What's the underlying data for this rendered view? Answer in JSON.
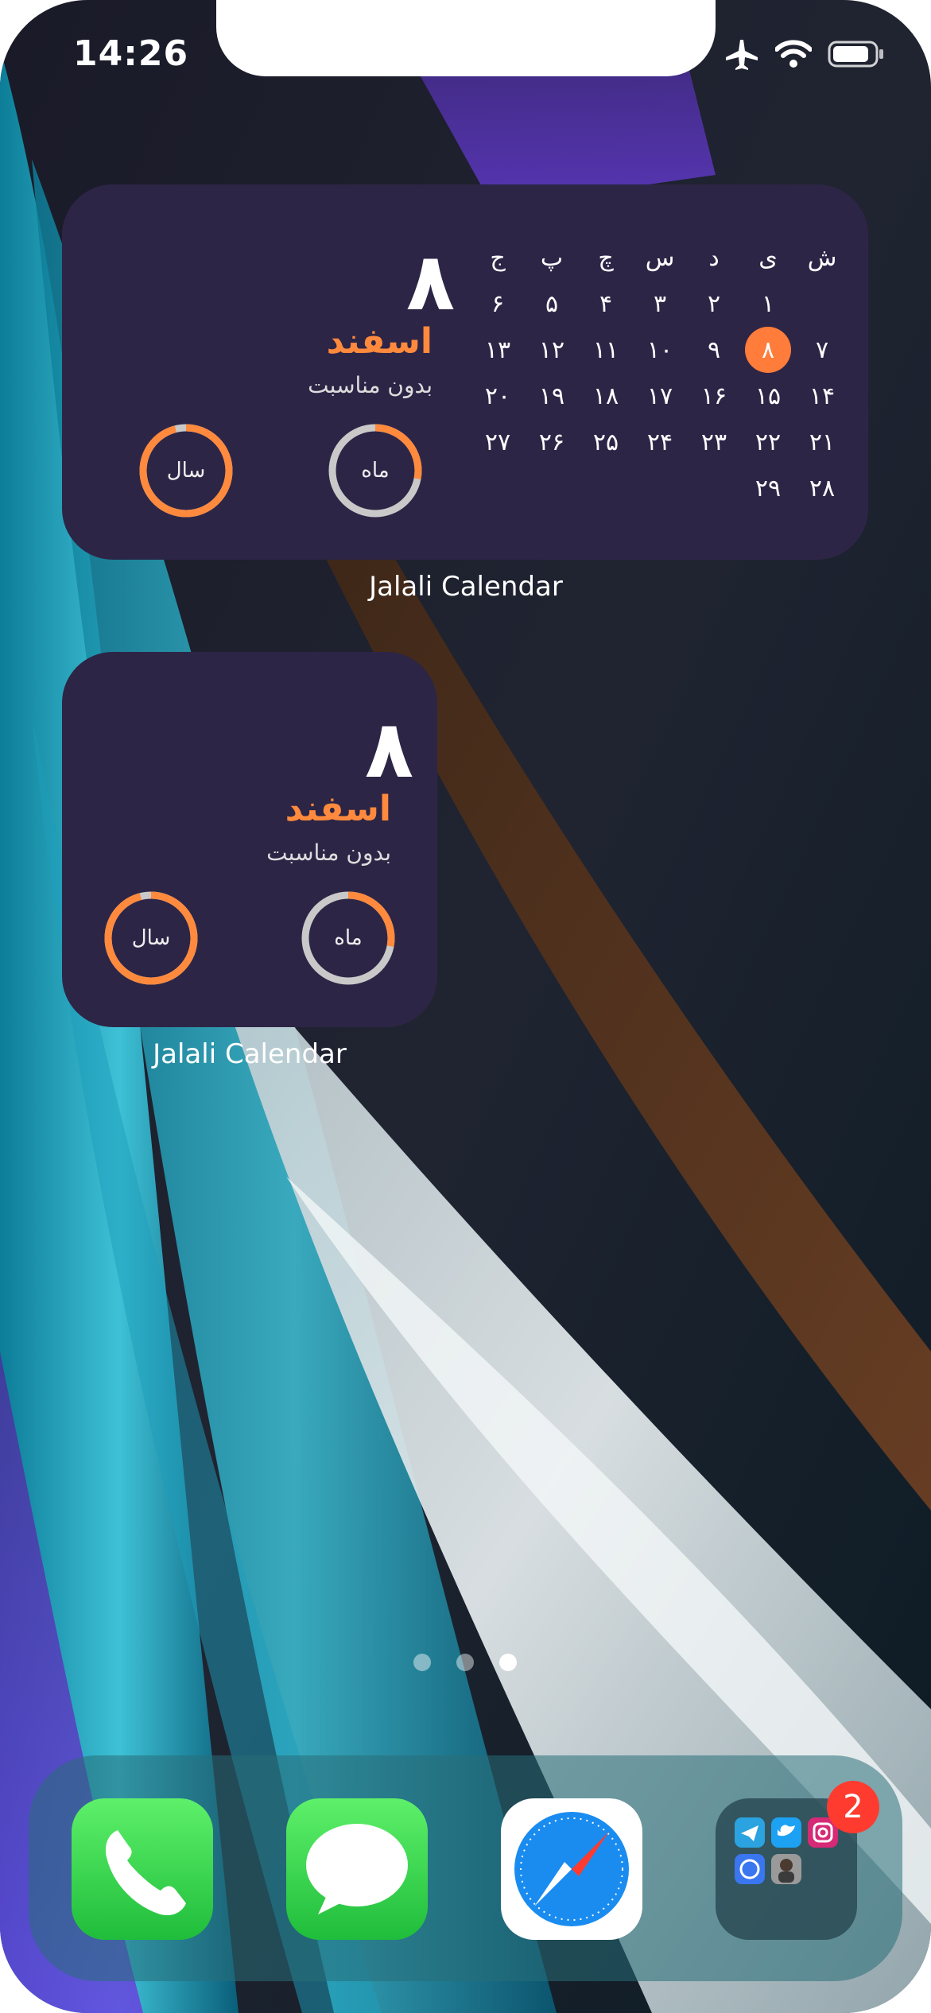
{
  "status_bar": {
    "time": "14:26"
  },
  "widget_large": {
    "day": "۸",
    "month": "اسفند",
    "occasion": "بدون مناسبت",
    "ring_month_label": "ماه",
    "ring_year_label": "سال",
    "ring_month_progress": 0.28,
    "ring_year_progress": 0.96,
    "weekday_headers": [
      "ش",
      "ی",
      "د",
      "س",
      "چ",
      "پ",
      "ج"
    ],
    "weeks": [
      [
        "",
        "۱",
        "۲",
        "۳",
        "۴",
        "۵",
        "۶"
      ],
      [
        "۷",
        "۸",
        "۹",
        "۱۰",
        "۱۱",
        "۱۲",
        "۱۳"
      ],
      [
        "۱۴",
        "۱۵",
        "۱۶",
        "۱۷",
        "۱۸",
        "۱۹",
        "۲۰"
      ],
      [
        "۲۱",
        "۲۲",
        "۲۳",
        "۲۴",
        "۲۵",
        "۲۶",
        "۲۷"
      ],
      [
        "۲۸",
        "۲۹",
        "",
        "",
        "",
        "",
        ""
      ]
    ],
    "today": "۸",
    "caption": "Jalali Calendar"
  },
  "widget_small": {
    "day": "۸",
    "month": "اسفند",
    "occasion": "بدون مناسبت",
    "ring_month_label": "ماه",
    "ring_year_label": "سال",
    "ring_month_progress": 0.28,
    "ring_year_progress": 0.96,
    "caption": "Jalali Calendar"
  },
  "page_dots": {
    "count": 3,
    "active_index": 2
  },
  "dock": {
    "apps": [
      "phone-icon",
      "messages-icon",
      "safari-icon",
      "folder-icon"
    ],
    "folder_badge": "2"
  },
  "colors": {
    "widget_bg": "#2d2546",
    "accent": "#ff7c3a",
    "badge": "#ff3b30"
  }
}
